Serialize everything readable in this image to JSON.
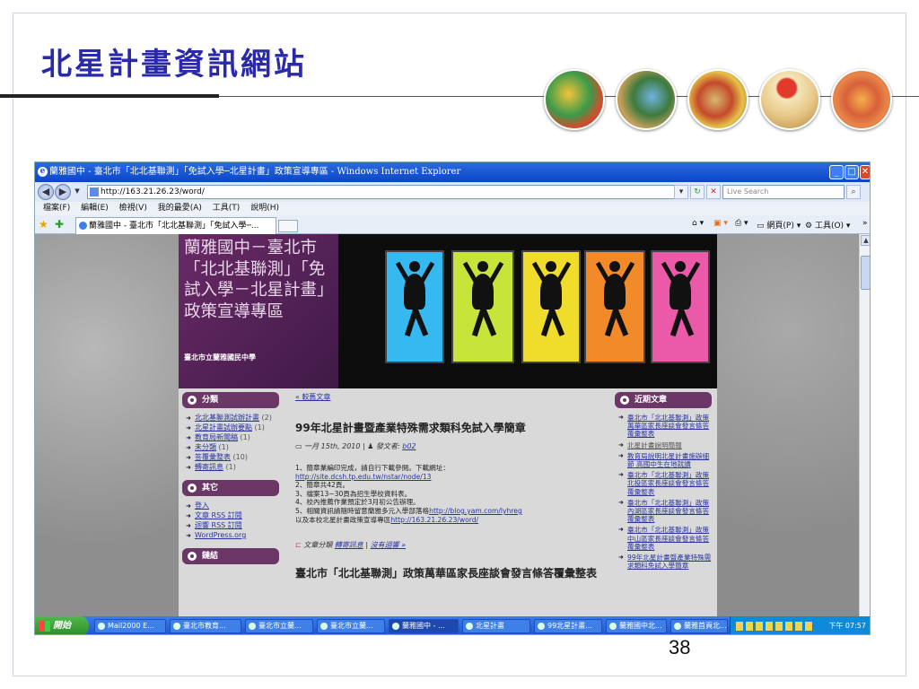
{
  "slide": {
    "title": "北星計畫資訊網站",
    "page_number": "38"
  },
  "browser": {
    "window_title": "蘭雅國中 - 臺北市「北北基聯測」「免試入學─北星計畫」政策宣導專區 - Windows Internet Explorer",
    "address": "http://163.21.26.23/word/",
    "search_placeholder": "Live Search",
    "menu": [
      "檔案(F)",
      "編輯(E)",
      "檢視(V)",
      "我的最愛(A)",
      "工具(T)",
      "說明(H)"
    ],
    "tab_label": "蘭雅國中 - 臺北市「北北基聯測」「免試入學─...",
    "command_bar": {
      "page": "網頁(P)",
      "tools": "工具(O)"
    }
  },
  "site": {
    "header_title": "蘭雅國中－臺北市「北北基聯測」「免試入學－北星計畫」政策宣導專區",
    "header_subtitle": "臺北市立蘭雅國民中學",
    "panel_colors": [
      "#36b8f0",
      "#c6e43a",
      "#f0dc2a",
      "#f28a2a",
      "#ea5aa8"
    ],
    "categories_heading": "分類",
    "categories": [
      {
        "label": "北北基聯測試辦計畫",
        "count": "(2)"
      },
      {
        "label": "北星計畫試辦要點",
        "count": "(1)"
      },
      {
        "label": "教育局新聞稿",
        "count": "(1)"
      },
      {
        "label": "未分類",
        "count": "(1)"
      },
      {
        "label": "答覆彙整表",
        "count": "(10)"
      },
      {
        "label": "轉寄訊息",
        "count": "(1)"
      }
    ],
    "other_heading": "其它",
    "other_links": [
      "登入",
      "文章 RSS 訂閱",
      "迴響 RSS 訂閱",
      "WordPress.org"
    ],
    "links_heading": "鏈結",
    "older_posts": "« 較舊文章",
    "post": {
      "title": "99年北星計畫暨產業特殊需求類科免試入學簡章",
      "date": "一月 15th, 2010",
      "author_label": "發文者:",
      "author": "b02",
      "body": [
        "1、簡章業編印完成，請自行下載參閱。下載網址：",
        "http://site.dcsh.tp.edu.tw/nstar/node/13",
        "2、簡章共42頁。",
        "3、檔案13~30頁為招生學校資料表。",
        "4、校內推薦作業預定於3月初公告辦理。",
        "5、相關資訊請隨時留意蘭雅多元入學部落格",
        "http://blog.yam.com/lyhreg",
        "以及本校北星計畫政策宣導專區",
        "http://163.21.26.23/word/"
      ],
      "foot_category_label": "文章分類",
      "foot_category": "轉寄訊息",
      "foot_comments": "沒有迴響 »"
    },
    "post2_title": "臺北市「北北基聯測」政策萬華區家長座談會發言條答覆彙整表",
    "recent_heading": "近期文章",
    "recent": [
      "臺北市「北北基聯測」政策萬華區家長座談會發言條答覆彙整表",
      "北星計畫說明簡報",
      "教育局說明北星計畫施辦細節 高國中生在地就讀",
      "臺北市「北北基聯測」政策北投區家長座談會發言條答覆彙整表",
      "臺北市「北北基聯測」政策內湖區家長座談會發言條答覆彙整表",
      "臺北市「北北基聯測」政策中山區家長座談會發言條答覆彙整表",
      "99年北星計畫暨產業特殊需求類科免試入學簡章"
    ]
  },
  "taskbar": {
    "start": "開始",
    "tasks": [
      "Mail2000 E...",
      "臺北市教育...",
      "臺北市立蘭...",
      "臺北市立蘭...",
      "蘭雅國中 - ...",
      "北星計畫",
      "99北星計畫...",
      "蘭雅國中北...",
      "蘭雅首頁北..."
    ],
    "clock": "下午 07:57"
  }
}
